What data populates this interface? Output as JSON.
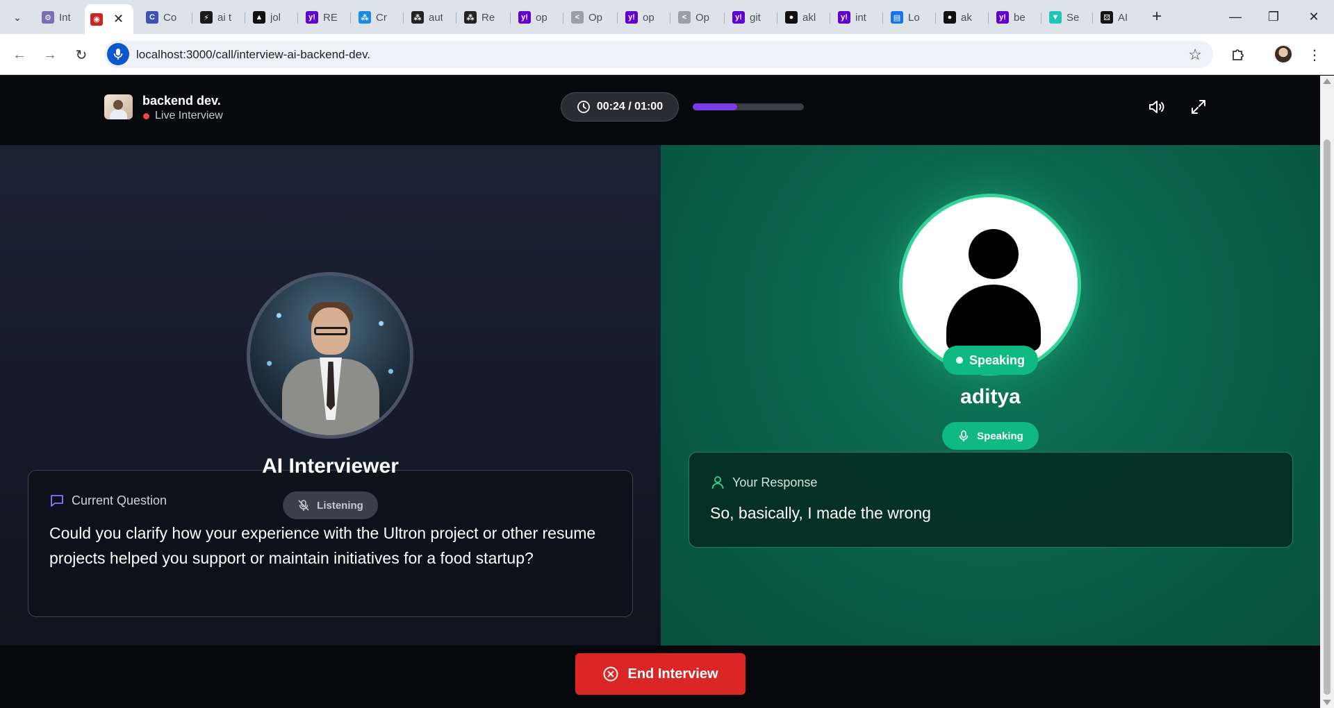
{
  "browser": {
    "tabs": [
      {
        "label": "Int",
        "color": "#7a6fb0",
        "glyph": "⚙"
      },
      {
        "label": "",
        "color": "#c62828",
        "glyph": "◉",
        "active": true
      },
      {
        "label": "Co",
        "color": "#3f51b5",
        "glyph": "C"
      },
      {
        "label": "ai t",
        "color": "#1b1b1b",
        "glyph": "⚡"
      },
      {
        "label": "jol",
        "color": "#111111",
        "glyph": "▲"
      },
      {
        "label": "RE",
        "color": "#6001d2",
        "glyph": "y!"
      },
      {
        "label": "Cr",
        "color": "#1e88e5",
        "glyph": "⁂"
      },
      {
        "label": "aut",
        "color": "#222222",
        "glyph": "⁂"
      },
      {
        "label": "Re",
        "color": "#222222",
        "glyph": "⁂"
      },
      {
        "label": "op",
        "color": "#6001d2",
        "glyph": "y!"
      },
      {
        "label": "Op",
        "color": "#9aa0a6",
        "glyph": "<"
      },
      {
        "label": "op",
        "color": "#6001d2",
        "glyph": "y!"
      },
      {
        "label": "Op",
        "color": "#9aa0a6",
        "glyph": "<"
      },
      {
        "label": "git",
        "color": "#6001d2",
        "glyph": "y!"
      },
      {
        "label": "akl",
        "color": "#111111",
        "glyph": "●"
      },
      {
        "label": "int",
        "color": "#6001d2",
        "glyph": "y!"
      },
      {
        "label": "Lo",
        "color": "#1a73e8",
        "glyph": "▤"
      },
      {
        "label": "ak",
        "color": "#111111",
        "glyph": "●"
      },
      {
        "label": "be",
        "color": "#6001d2",
        "glyph": "y!"
      },
      {
        "label": "Se",
        "color": "#1ec6b6",
        "glyph": "▼"
      },
      {
        "label": "AI",
        "color": "#111111",
        "glyph": "⚄"
      }
    ],
    "url": "localhost:3000/call/interview-ai-backend-dev."
  },
  "header": {
    "job_title": "backend dev.",
    "status_label": "Live Interview",
    "timer": "00:24 / 01:00",
    "progress_fraction": 0.4
  },
  "interviewer": {
    "name": "AI Interviewer",
    "status": "Listening"
  },
  "question": {
    "heading": "Current Question",
    "text": "Could you clarify how your experience with the Ultron project or other resume projects helped you support or maintain initiatives for a food startup?"
  },
  "candidate": {
    "name": "aditya",
    "badge": "Speaking",
    "status": "Speaking"
  },
  "response": {
    "heading": "Your Response",
    "text": "So, basically, I made the wrong"
  },
  "actions": {
    "end_label": "End Interview"
  },
  "colors": {
    "accent_purple": "#7c3aed",
    "speaking_green": "#10b981",
    "end_red": "#dc2626",
    "live_red": "#ef4444"
  }
}
